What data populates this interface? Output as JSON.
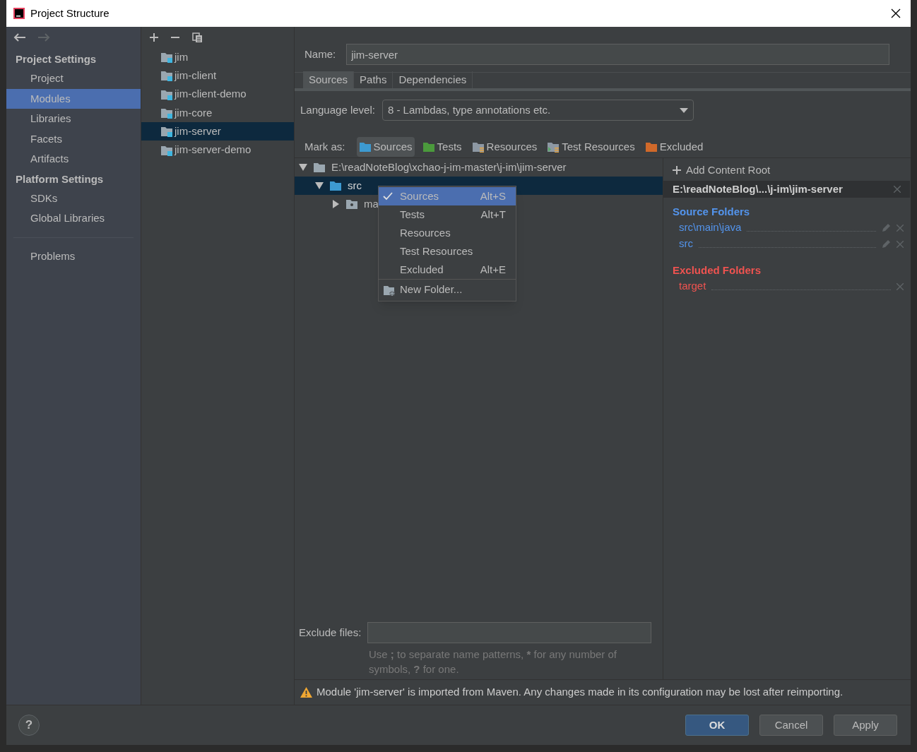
{
  "window": {
    "title": "Project Structure"
  },
  "nav": {
    "back_disabled": false,
    "forward_disabled": true
  },
  "sidebar": {
    "sections": [
      {
        "heading": "Project Settings",
        "items": [
          {
            "label": "Project",
            "selected": false
          },
          {
            "label": "Modules",
            "selected": true
          },
          {
            "label": "Libraries",
            "selected": false
          },
          {
            "label": "Facets",
            "selected": false
          },
          {
            "label": "Artifacts",
            "selected": false
          }
        ]
      },
      {
        "heading": "Platform Settings",
        "items": [
          {
            "label": "SDKs",
            "selected": false
          },
          {
            "label": "Global Libraries",
            "selected": false
          }
        ]
      }
    ],
    "footer_items": [
      {
        "label": "Problems",
        "selected": false
      }
    ]
  },
  "modules": [
    {
      "label": "jim",
      "selected": false
    },
    {
      "label": "jim-client",
      "selected": false
    },
    {
      "label": "jim-client-demo",
      "selected": false
    },
    {
      "label": "jim-core",
      "selected": false
    },
    {
      "label": "jim-server",
      "selected": true
    },
    {
      "label": "jim-server-demo",
      "selected": false
    }
  ],
  "name_field": {
    "label": "Name:",
    "value": "jim-server"
  },
  "tabs": [
    {
      "label": "Sources",
      "selected": true
    },
    {
      "label": "Paths",
      "selected": false
    },
    {
      "label": "Dependencies",
      "selected": false
    }
  ],
  "language_level": {
    "label": "Language level:",
    "value": "8 - Lambdas, type annotations etc."
  },
  "mark_as": {
    "label": "Mark as:",
    "buttons": [
      {
        "label": "Sources",
        "kind": "sources",
        "selected": true
      },
      {
        "label": "Tests",
        "kind": "tests",
        "selected": false
      },
      {
        "label": "Resources",
        "kind": "resources",
        "selected": false
      },
      {
        "label": "Test Resources",
        "kind": "test-resources",
        "selected": false
      },
      {
        "label": "Excluded",
        "kind": "excluded",
        "selected": false
      }
    ]
  },
  "tree": [
    {
      "label": "E:\\readNoteBlog\\xchao-j-im-master\\j-im\\jim-server",
      "kind": "plain",
      "expanded": true,
      "selected": false,
      "children": [
        {
          "label": "src",
          "kind": "source",
          "expanded": true,
          "selected": true,
          "children": [
            {
              "label": "ma",
              "kind": "package",
              "expanded": false,
              "selected": false
            }
          ]
        }
      ]
    }
  ],
  "context_menu": [
    {
      "label": "Sources",
      "shortcut": "Alt+S",
      "kind": "mark",
      "checked": true,
      "selected": true
    },
    {
      "label": "Tests",
      "shortcut": "Alt+T",
      "kind": "mark",
      "checked": false,
      "selected": false
    },
    {
      "label": "Resources",
      "kind": "mark",
      "checked": false,
      "selected": false
    },
    {
      "label": "Test Resources",
      "kind": "mark",
      "checked": false,
      "selected": false
    },
    {
      "label": "Excluded",
      "shortcut": "Alt+E",
      "kind": "mark",
      "checked": false,
      "selected": false
    },
    {
      "label": "New Folder...",
      "kind": "action",
      "checked": false,
      "selected": false
    }
  ],
  "content_root": {
    "add_label": "Add Content Root",
    "path": "E:\\readNoteBlog\\...\\j-im\\jim-server",
    "groups": [
      {
        "title": "Source Folders",
        "kind": "source",
        "folders": [
          "src\\main\\java",
          "src"
        ]
      },
      {
        "title": "Excluded Folders",
        "kind": "excluded",
        "folders": [
          "target"
        ]
      }
    ]
  },
  "exclude_files": {
    "label": "Exclude files:",
    "hint": "Use **;** to separate name patterns, ***** for any number of symbols, **?** for one."
  },
  "warning": "Module 'jim-server' is imported from Maven. Any changes made in its configuration may be lost after reimporting.",
  "help_button": "?",
  "buttons": [
    {
      "label": "OK",
      "kind": "primary"
    },
    {
      "label": "Cancel",
      "kind": "normal"
    },
    {
      "label": "Apply",
      "kind": "normal"
    }
  ]
}
